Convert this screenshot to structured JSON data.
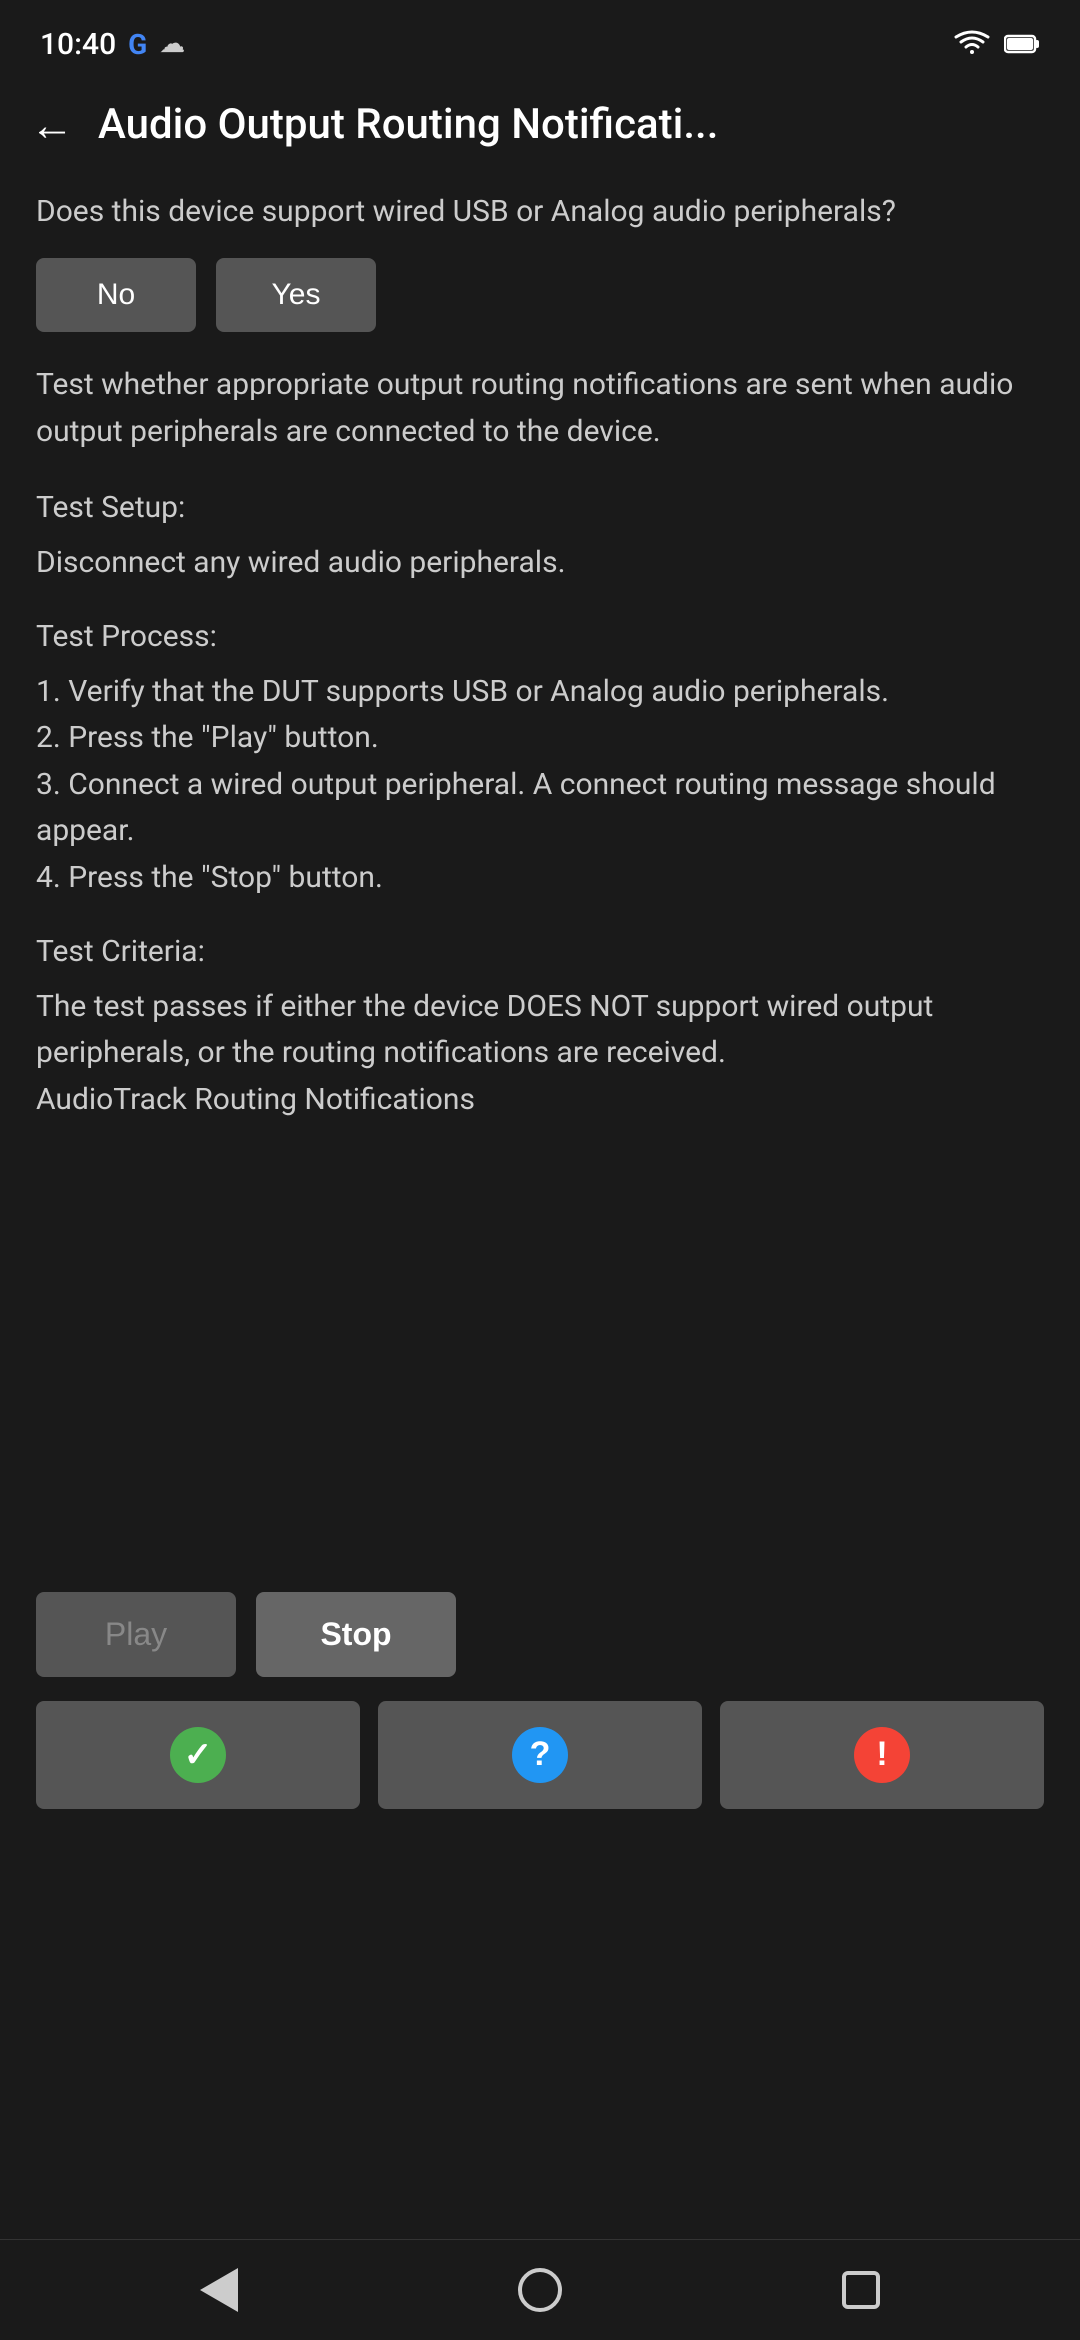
{
  "statusBar": {
    "time": "10:40",
    "googleIcon": "G",
    "cloudIcon": "☁"
  },
  "header": {
    "backArrow": "←",
    "title": "Audio Output Routing Notificati..."
  },
  "content": {
    "questionText": "Does this device support wired USB or Analog audio peripherals?",
    "noLabel": "No",
    "yesLabel": "Yes",
    "descriptionText": "Test whether appropriate output routing notifications are sent when audio output peripherals are connected to the device.",
    "testSetupTitle": "Test Setup:",
    "testSetupBody": "Disconnect any wired audio peripherals.",
    "testProcessTitle": "Test Process:",
    "testProcessBody": "1. Verify that the DUT supports USB or Analog audio peripherals.\n2. Press the \"Play\" button.\n3. Connect a wired output peripheral. A connect routing message should appear.\n4. Press the \"Stop\" button.",
    "testCriteriaTitle": "Test Criteria:",
    "testCriteriaBody": "The test passes if either the device DOES NOT support wired output peripherals, or the routing notifications are received.\nAudioTrack Routing Notifications"
  },
  "controls": {
    "playLabel": "Play",
    "stopLabel": "Stop",
    "passIcon": "✓",
    "infoIcon": "?",
    "failIcon": "!"
  },
  "navBar": {
    "backLabel": "back",
    "homeLabel": "home",
    "recentLabel": "recent"
  }
}
